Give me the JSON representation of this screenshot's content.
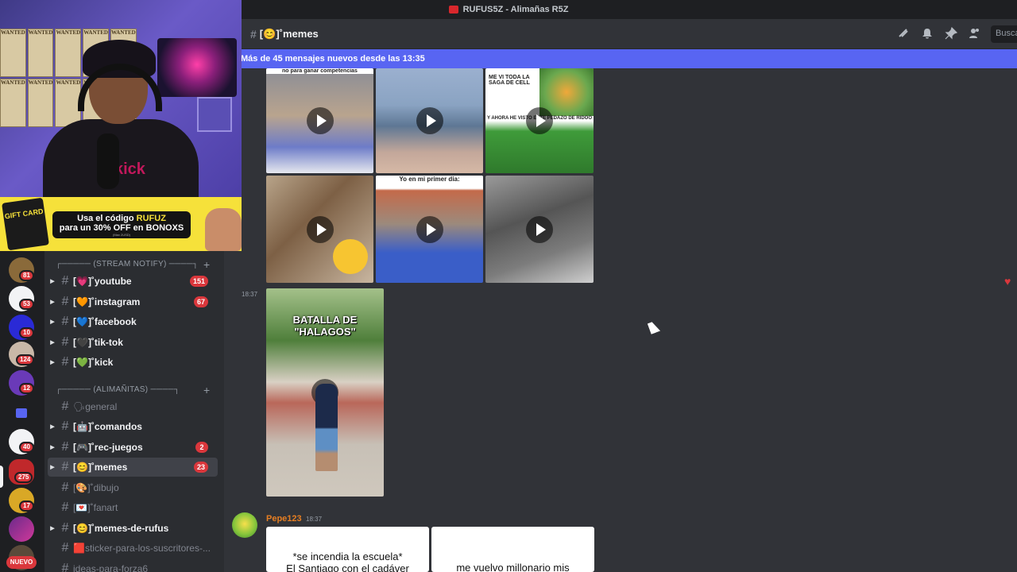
{
  "window": {
    "title": "RUFUS5Z - Alimañas R5Z"
  },
  "header": {
    "channel_name": "[😊]˚memes",
    "search_placeholder": "Busca",
    "icons": [
      "threads-icon",
      "bell-icon",
      "pin-icon",
      "members-icon"
    ]
  },
  "new_messages_bar": {
    "text": "Más de 45 mensajes nuevos desde las 13:35"
  },
  "ad": {
    "card_text": "GIFT CARD",
    "line1_pre": "Usa el código ",
    "line1_code": "RUFUZ",
    "line2_pre": "para un 30% OFF en ",
    "line2_brand": "BONOXS",
    "fine_print": "(Max 2USD)"
  },
  "webcam": {
    "shirt_text": "kick"
  },
  "server_badges": [
    "81",
    "53",
    "10",
    "124",
    "12",
    "40",
    "275",
    "17"
  ],
  "server_new_label": "NUEVO",
  "categories": [
    {
      "label": "┌───── (STREAM NOTIFY) ────┐"
    },
    {
      "label": "┌───── (ALIMAÑITAS) ────┐"
    }
  ],
  "channels": [
    {
      "label": "[💗]˚youtube",
      "badge": "151"
    },
    {
      "label": "[🧡]˚instagram",
      "badge": "67"
    },
    {
      "label": "[💙]˚facebook",
      "badge": ""
    },
    {
      "label": "[🖤]˚tik-tok",
      "badge": ""
    },
    {
      "label": "[💚]˚kick",
      "badge": ""
    },
    {
      "label": "🗣general",
      "badge": ""
    },
    {
      "label": "[🤖]˚comandos",
      "badge": ""
    },
    {
      "label": "[🎮]˚rec-juegos",
      "badge": "2"
    },
    {
      "label": "[😊]˚memes",
      "badge": "23"
    },
    {
      "label": "[🎨]˚dibujo",
      "badge": ""
    },
    {
      "label": "[💌]˚fanart",
      "badge": ""
    },
    {
      "label": "[😊]˚memes-de-rufus",
      "badge": ""
    },
    {
      "label": "🟥sticker-para-los-suscritores-...",
      "badge": ""
    },
    {
      "label": "ideas-para-forza6",
      "badge": ""
    }
  ],
  "media": {
    "captions": {
      "t1": "no para ganar competencias",
      "t3a": "ME VI TODA LA SAGA DE CELL",
      "t3b": "Y AHORA HE VISTO ESTE PEDAZO DE RIDOO",
      "t5": "Yo en mi primer dia:",
      "batalla": "BATALLA DE \"HALAGOS\""
    }
  },
  "messages": [
    {
      "time": "18:37"
    },
    {
      "author": "Pepe123",
      "time": "18:37"
    }
  ],
  "cards": {
    "left_line1": "*se incendia la escuela*",
    "left_line2": "El Santiago con el cadáver",
    "right_line1": "me vuelvo millonario mis"
  },
  "colors": {
    "accent": "#5865f2",
    "badge": "#da373c",
    "author": "#e67e22"
  }
}
